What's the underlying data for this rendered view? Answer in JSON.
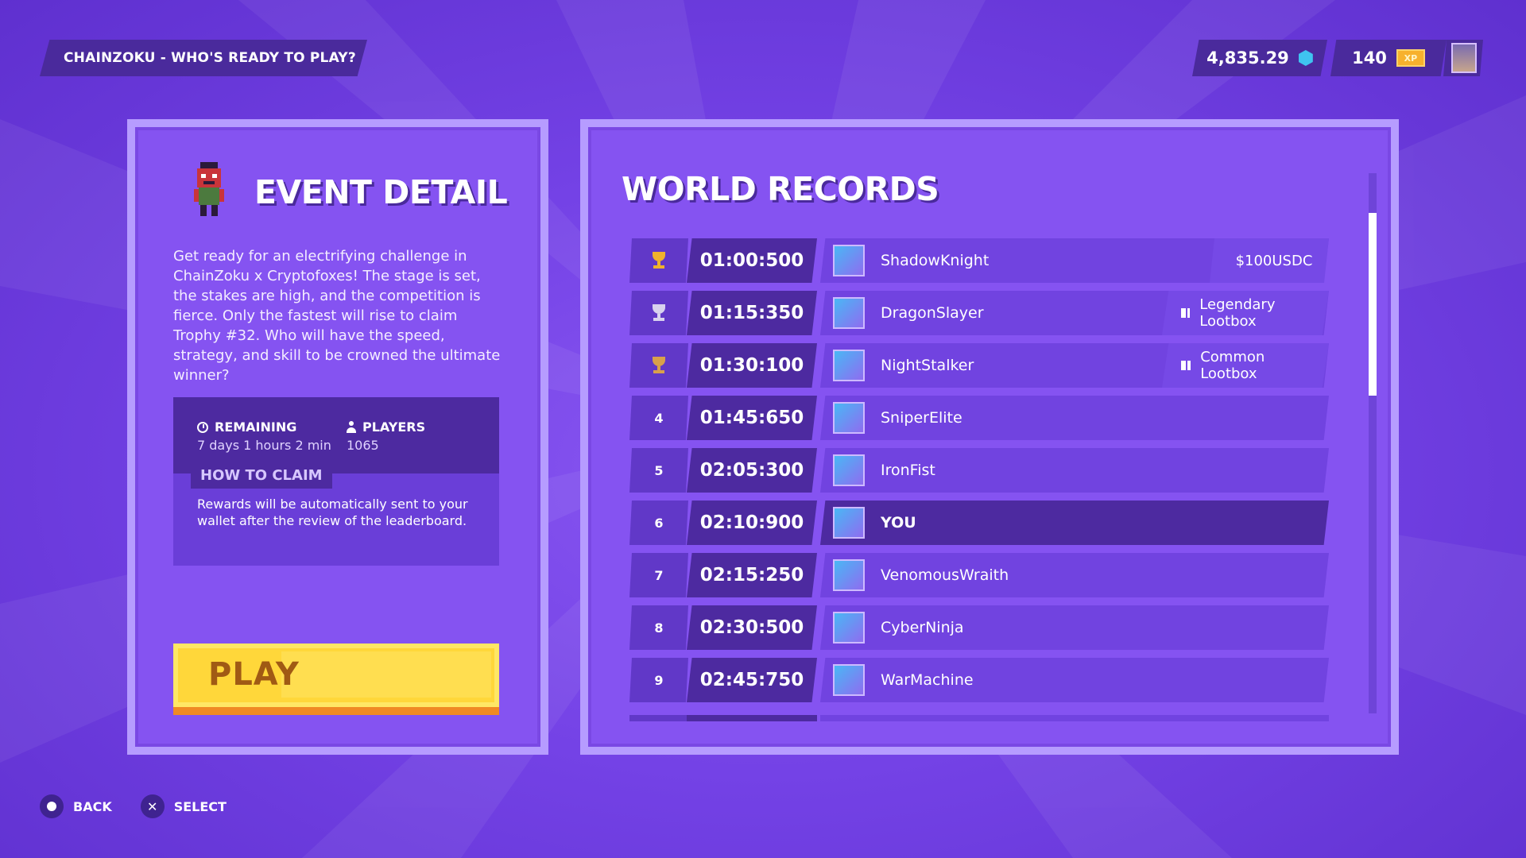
{
  "header": {
    "title": "CHAINZOKU - WHO'S READY TO PLAY?",
    "balance": "4,835.29",
    "xp_value": "140",
    "xp_badge": "XP"
  },
  "event": {
    "title": "EVENT DETAIL",
    "description": "Get ready for an electrifying challenge in ChainZoku x Cryptofoxes! The stage is set, the stakes are high, and the competition is fierce. Only the fastest will rise to claim Trophy #32. Who will have the speed, strategy, and skill to be crowned the ultimate winner?",
    "remaining_label": "REMAINING",
    "remaining_value": "7 days 1 hours 2 min",
    "players_label": "PLAYERS",
    "players_value": "1065",
    "how_to_claim_label": "HOW TO CLAIM",
    "how_to_claim_text": "Rewards will be automatically sent to your wallet after the review of the leaderboard.",
    "play_label": "PLAY"
  },
  "records": {
    "title": "WORLD RECORDS",
    "rows": [
      {
        "rank": "",
        "trophy": "gold",
        "time": "01:00:500",
        "name": "ShadowKnight",
        "prize": "$100USDC"
      },
      {
        "rank": "",
        "trophy": "silver",
        "time": "01:15:350",
        "name": "DragonSlayer",
        "prize": "Legendary Lootbox"
      },
      {
        "rank": "",
        "trophy": "bronze",
        "time": "01:30:100",
        "name": "NightStalker",
        "prize": "Common Lootbox"
      },
      {
        "rank": "4",
        "time": "01:45:650",
        "name": "SniperElite"
      },
      {
        "rank": "5",
        "time": "02:05:300",
        "name": "IronFist"
      },
      {
        "rank": "6",
        "time": "02:10:900",
        "name": "YOU",
        "me": true
      },
      {
        "rank": "7",
        "time": "02:15:250",
        "name": "VenomousWraith"
      },
      {
        "rank": "8",
        "time": "02:30:500",
        "name": "CyberNinja"
      },
      {
        "rank": "9",
        "time": "02:45:750",
        "name": "WarMachine"
      }
    ]
  },
  "footer": {
    "back_label": "BACK",
    "select_label": "SELECT"
  },
  "colors": {
    "accent": "#8553f1",
    "panel_border": "#b69cff",
    "dark": "#4d2aa0",
    "play": "#ffd73a",
    "gold": "#f0b22c"
  }
}
